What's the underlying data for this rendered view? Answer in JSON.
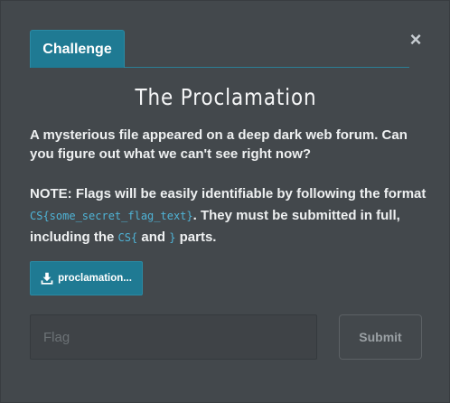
{
  "modal": {
    "close_glyph": "×",
    "tabs": [
      {
        "label": "Challenge"
      }
    ],
    "title": "The Proclamation",
    "description": "A mysterious file appeared on a deep dark web forum. Can you figure out what we can't see right now?",
    "note": {
      "prefix": "NOTE: Flags will be easily identifiable by following the format",
      "format_code": "CS{some_secret_flag_text}",
      "middle": ". They must be submitted in full, including the",
      "open_code": "CS{",
      "and": "and",
      "close_code": "}",
      "suffix": "parts."
    },
    "file_button": {
      "label": "proclamation...",
      "icon": "download-icon"
    },
    "flag_input": {
      "placeholder": "Flag",
      "value": ""
    },
    "submit_label": "Submit"
  },
  "colors": {
    "accent": "#1f7a93",
    "background": "#43484c",
    "code": "#4fb3d6"
  }
}
